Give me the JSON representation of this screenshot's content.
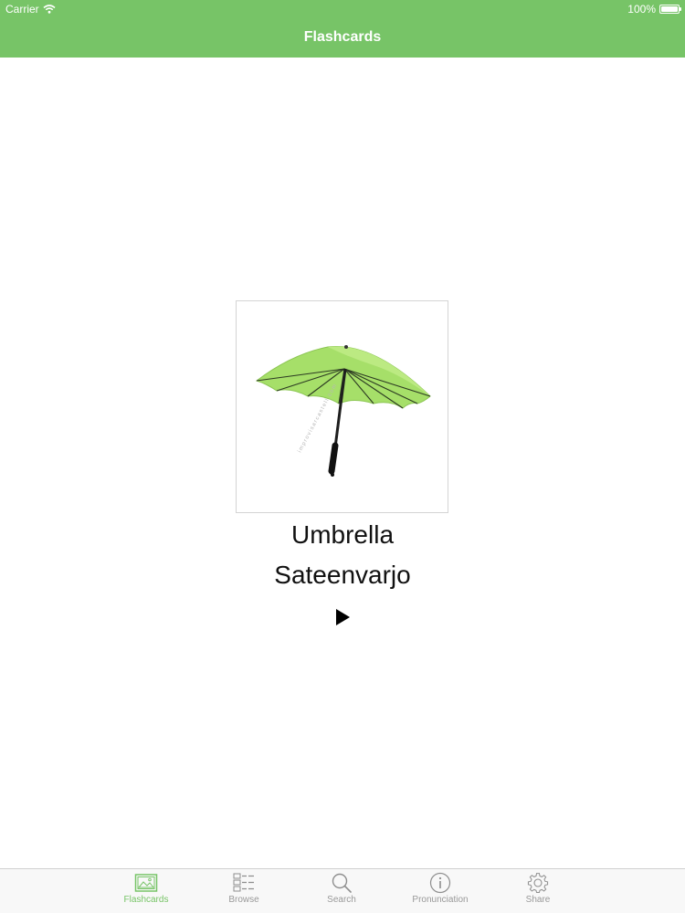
{
  "status_bar": {
    "carrier": "Carrier",
    "battery": "100%",
    "battery_level": 1.0
  },
  "nav": {
    "title": "Flashcards"
  },
  "card": {
    "word": "Umbrella",
    "translation": "Sateenvarjo",
    "image_watermark": "improvisarcastell.com"
  },
  "tabs": [
    {
      "label": "Flashcards",
      "icon": "picture-icon",
      "active": true
    },
    {
      "label": "Browse",
      "icon": "list-icon",
      "active": false
    },
    {
      "label": "Search",
      "icon": "search-icon",
      "active": false
    },
    {
      "label": "Pronunciation",
      "icon": "info-icon",
      "active": false
    },
    {
      "label": "Share",
      "icon": "gear-icon",
      "active": false
    }
  ],
  "colors": {
    "accent": "#77c467",
    "tab_inactive": "#999999",
    "umbrella": "#a8e06a"
  }
}
